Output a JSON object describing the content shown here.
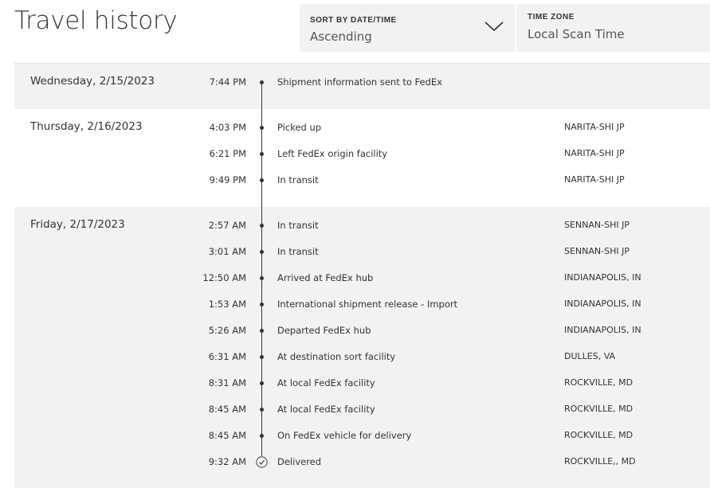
{
  "page": {
    "title": "Travel history"
  },
  "sort": {
    "label": "SORT BY DATE/TIME",
    "value": "Ascending"
  },
  "timezone": {
    "label": "TIME ZONE",
    "value": "Local Scan Time"
  },
  "colors": {
    "shaded_row": "#f2f2f2",
    "text": "#333333",
    "timeline": "#333333"
  },
  "icons": {
    "sort_toggle": "chevron-down-icon",
    "event_marker": "dot-icon",
    "delivered_marker": "check-circle-icon"
  },
  "days": [
    {
      "date": "Wednesday, 2/15/2023",
      "shaded": true,
      "events": [
        {
          "time": "7:44 PM",
          "description": "Shipment information sent to FedEx",
          "location": ""
        }
      ]
    },
    {
      "date": "Thursday, 2/16/2023",
      "shaded": false,
      "events": [
        {
          "time": "4:03 PM",
          "description": "Picked up",
          "location": "NARITA-SHI JP"
        },
        {
          "time": "6:21 PM",
          "description": "Left FedEx origin facility",
          "location": "NARITA-SHI JP"
        },
        {
          "time": "9:49 PM",
          "description": "In transit",
          "location": "NARITA-SHI JP"
        }
      ]
    },
    {
      "date": "Friday, 2/17/2023",
      "shaded": true,
      "events": [
        {
          "time": "2:57 AM",
          "description": "In transit",
          "location": "SENNAN-SHI JP"
        },
        {
          "time": "3:01 AM",
          "description": "In transit",
          "location": "SENNAN-SHI JP"
        },
        {
          "time": "12:50 AM",
          "description": "Arrived at FedEx hub",
          "location": "INDIANAPOLIS, IN"
        },
        {
          "time": "1:53 AM",
          "description": "International shipment release - Import",
          "location": "INDIANAPOLIS, IN"
        },
        {
          "time": "5:26 AM",
          "description": "Departed FedEx hub",
          "location": "INDIANAPOLIS, IN"
        },
        {
          "time": "6:31 AM",
          "description": "At destination sort facility",
          "location": "DULLES, VA"
        },
        {
          "time": "8:31 AM",
          "description": "At local FedEx facility",
          "location": "ROCKVILLE, MD"
        },
        {
          "time": "8:45 AM",
          "description": "At local FedEx facility",
          "location": "ROCKVILLE, MD"
        },
        {
          "time": "8:45 AM",
          "description": "On FedEx vehicle for delivery",
          "location": "ROCKVILLE, MD"
        },
        {
          "time": "9:32 AM",
          "description": "Delivered",
          "location": "ROCKVILLE,, MD",
          "delivered": true
        }
      ]
    }
  ]
}
